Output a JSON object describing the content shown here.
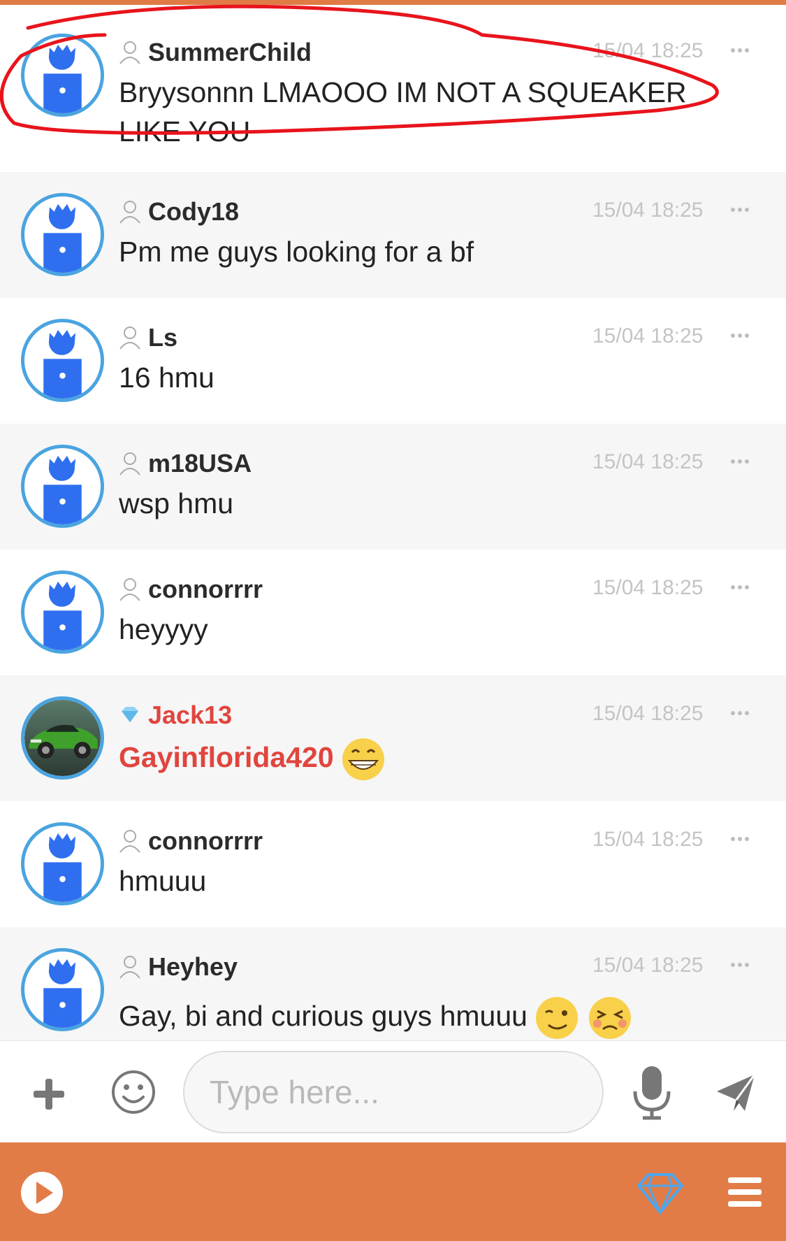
{
  "messages": [
    {
      "username": "SummerChild",
      "time": "15/04 18:25",
      "text": "Bryysonnn LMAOOO IM NOT A SQUEAKER LIKE YOU",
      "avatar": "default-avatar",
      "badge": "user-icon"
    },
    {
      "username": "Cody18",
      "time": "15/04 18:25",
      "text": "Pm me guys looking for a bf",
      "avatar": "default-avatar",
      "badge": "user-icon"
    },
    {
      "username": "Ls",
      "time": "15/04 18:25",
      "text": "16 hmu",
      "avatar": "default-avatar",
      "badge": "user-icon"
    },
    {
      "username": "m18USA",
      "time": "15/04 18:25",
      "text": "wsp hmu",
      "avatar": "default-avatar",
      "badge": "user-icon"
    },
    {
      "username": "connorrrr",
      "time": "15/04 18:25",
      "text": "heyyyy",
      "avatar": "default-avatar",
      "badge": "user-icon"
    },
    {
      "username": "Jack13",
      "time": "15/04 18:25",
      "text": "Gayinflorida420",
      "avatar": "green-car-photo",
      "badge": "diamond-icon",
      "emoji": [
        "grinning-emoji"
      ]
    },
    {
      "username": "connorrrr",
      "time": "15/04 18:25",
      "text": "hmuuu",
      "avatar": "default-avatar",
      "badge": "user-icon"
    },
    {
      "username": "Heyhey",
      "time": "15/04 18:25",
      "text": "Gay, bi and curious guys hmuuu",
      "avatar": "default-avatar",
      "badge": "user-icon",
      "emoji": [
        "winking-emoji",
        "persevering-emoji"
      ]
    }
  ],
  "input": {
    "placeholder": "Type here...",
    "value": ""
  },
  "colors": {
    "accent": "#e27c47",
    "vip": "#e0453e",
    "avatar_ring": "#4aa4e0",
    "avatar_fill": "#2f6fef",
    "annotation": "#e8141c"
  },
  "icons": [
    "plus-icon",
    "smiley-icon",
    "microphone-icon",
    "send-icon",
    "play-icon",
    "diamond-icon",
    "menu-icon",
    "more-icon",
    "user-icon"
  ]
}
